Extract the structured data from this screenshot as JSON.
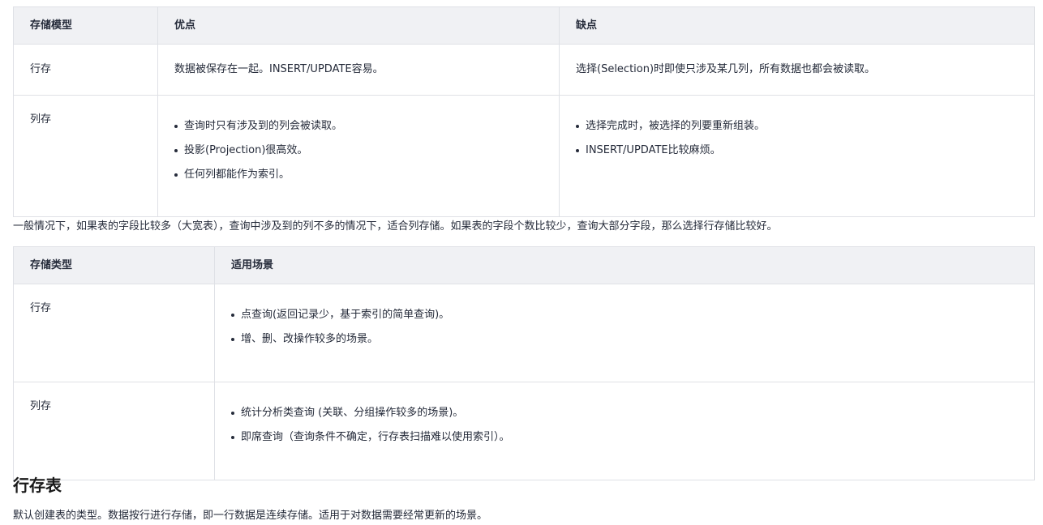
{
  "table1": {
    "headers": [
      "存储模型",
      "优点",
      "缺点"
    ],
    "rows": [
      {
        "model": "行存",
        "pros": "数据被保存在一起。INSERT/UPDATE容易。",
        "cons": "选择(Selection)时即使只涉及某几列，所有数据也都会被读取。"
      },
      {
        "model": "列存",
        "pros": [
          "查询时只有涉及到的列会被读取。",
          "投影(Projection)很高效。",
          "任何列都能作为索引。"
        ],
        "cons": [
          "选择完成时，被选择的列要重新组装。",
          "INSERT/UPDATE比较麻烦。"
        ]
      }
    ]
  },
  "paragraph1": "一般情况下，如果表的字段比较多（大宽表），查询中涉及到的列不多的情况下，适合列存储。如果表的字段个数比较少，查询大部分字段，那么选择行存储比较好。",
  "table2": {
    "headers": [
      "存储类型",
      "适用场景"
    ],
    "rows": [
      {
        "type": "行存",
        "scenarios": [
          "点查询(返回记录少，基于索引的简单查询)。",
          "增、删、改操作较多的场景。"
        ]
      },
      {
        "type": "列存",
        "scenarios": [
          "统计分析类查询 (关联、分组操作较多的场景)。",
          "即席查询（查询条件不确定，行存表扫描难以使用索引）。"
        ]
      }
    ]
  },
  "section_heading": "行存表",
  "paragraph2": "默认创建表的类型。数据按行进行存储，即一行数据是连续存储。适用于对数据需要经常更新的场景。"
}
